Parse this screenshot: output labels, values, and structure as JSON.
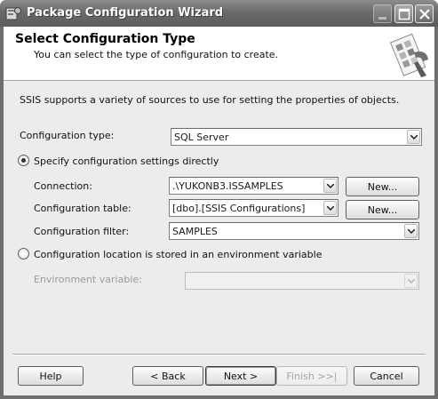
{
  "window": {
    "title": "Package Configuration Wizard"
  },
  "header": {
    "title": "Select Configuration Type",
    "subtitle": "You can select the type of configuration to create."
  },
  "description": "SSIS supports a variety of sources to use for setting the properties of objects.",
  "config_type": {
    "label": "Configuration type:",
    "value": "SQL Server"
  },
  "option_direct": {
    "label": "Specify configuration settings directly",
    "selected": true,
    "connection": {
      "label": "Connection:",
      "value": ".\\YUKONB3.ISSAMPLES",
      "new_button": "New..."
    },
    "table": {
      "label": "Configuration table:",
      "value": "[dbo].[SSIS Configurations]",
      "new_button": "New..."
    },
    "filter": {
      "label": "Configuration filter:",
      "value": "SAMPLES"
    }
  },
  "option_env": {
    "label": "Configuration location is stored in an environment variable",
    "selected": false,
    "env_var": {
      "label": "Environment variable:",
      "value": ""
    }
  },
  "footer": {
    "help": "Help",
    "back": "< Back",
    "next": "Next >",
    "finish": "Finish >>|",
    "cancel": "Cancel"
  }
}
